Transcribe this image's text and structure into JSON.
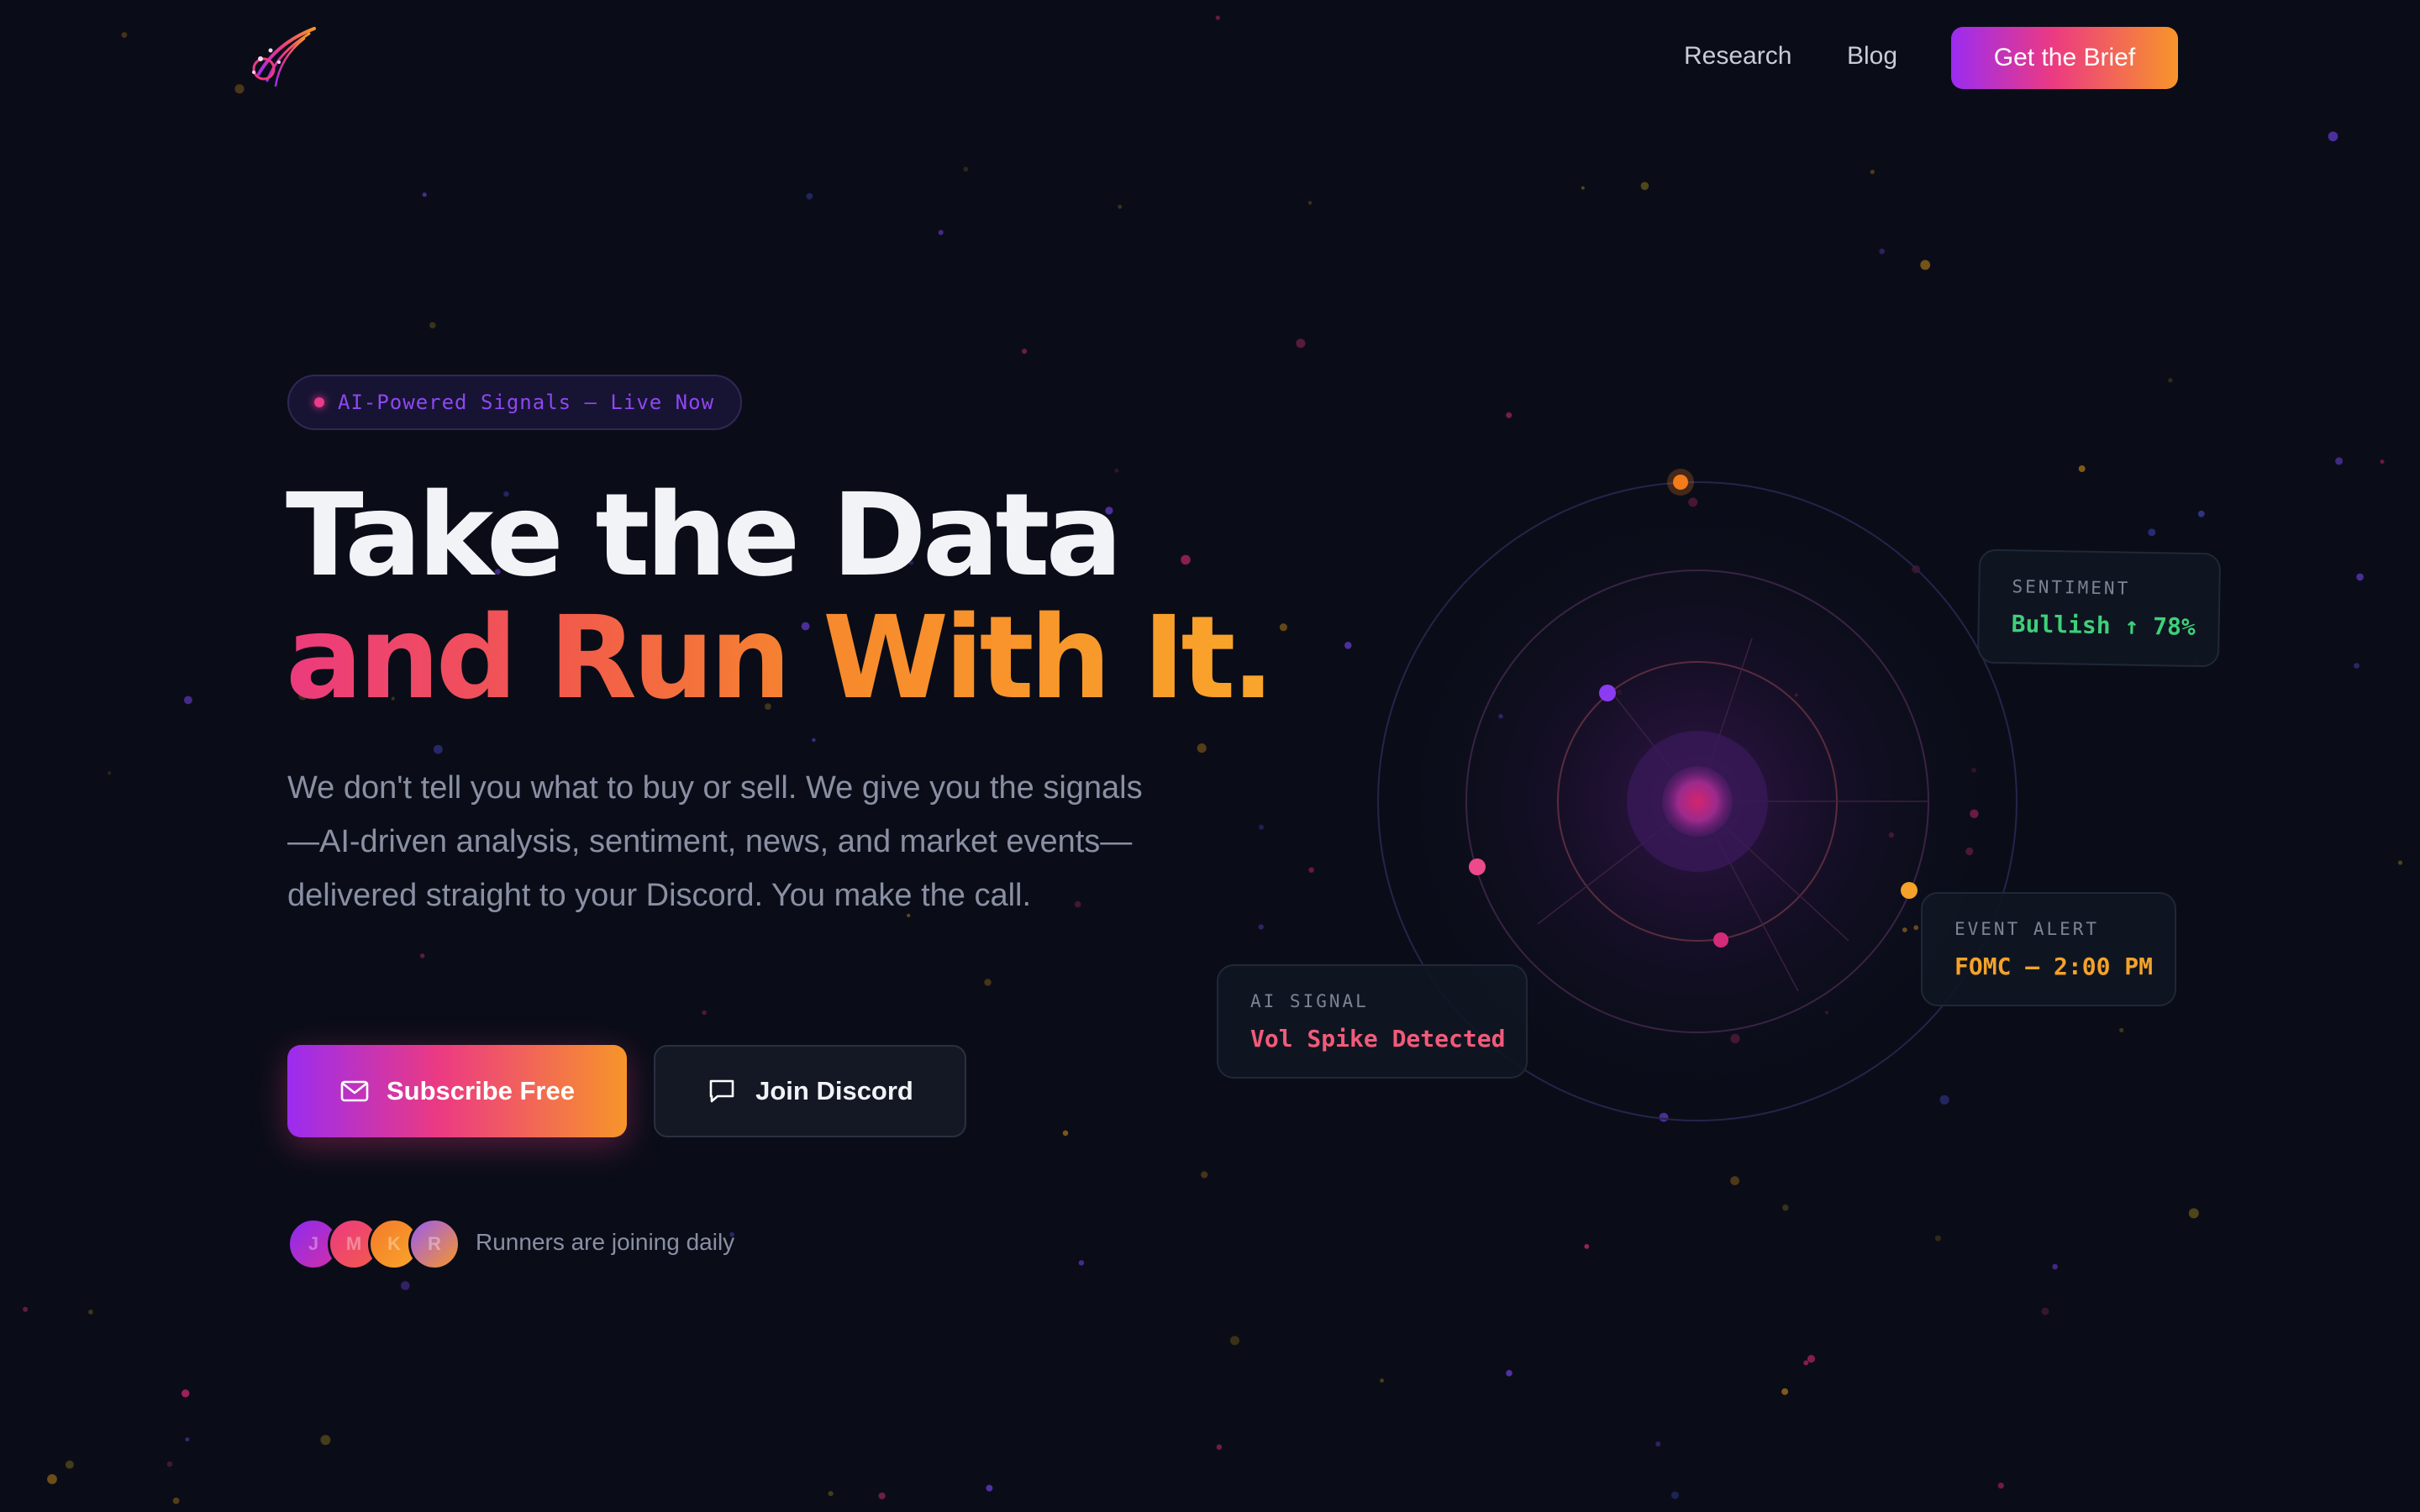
{
  "nav": {
    "links": [
      "Research",
      "Blog"
    ],
    "cta_label": "Get the Brief"
  },
  "hero": {
    "badge": "AI-Powered Signals — Live Now",
    "headline_line1": "Take the Data",
    "headline_line2": "and Run With It.",
    "subtext": "We don't tell you what to buy or sell. We give you the signals—AI-driven analysis, sentiment, news, and market events—delivered straight to your Discord. You make the call.",
    "primary_button": "Subscribe Free",
    "secondary_button": "Join Discord",
    "avatars": [
      "J",
      "M",
      "K",
      "R"
    ],
    "social_proof": "Runners are joining daily"
  },
  "cards": {
    "sentiment": {
      "label": "SENTIMENT",
      "value": "Bullish ↑ 78%"
    },
    "event": {
      "label": "EVENT ALERT",
      "value": "FOMC — 2:00 PM"
    },
    "ai_signal": {
      "label": "AI SIGNAL",
      "value": "Vol Spike Detected"
    }
  },
  "icons": {
    "logo": "comet-logo-icon",
    "subscribe": "mail-icon",
    "discord": "chat-bubble-icon"
  },
  "colors": {
    "background": "#0a0d18",
    "gradient_start": "#9b2cf0",
    "gradient_mid": "#ec3a82",
    "gradient_end": "#f7952a",
    "bullish": "#3ed07a",
    "event": "#f4a22a",
    "alert": "#f25a7a"
  }
}
